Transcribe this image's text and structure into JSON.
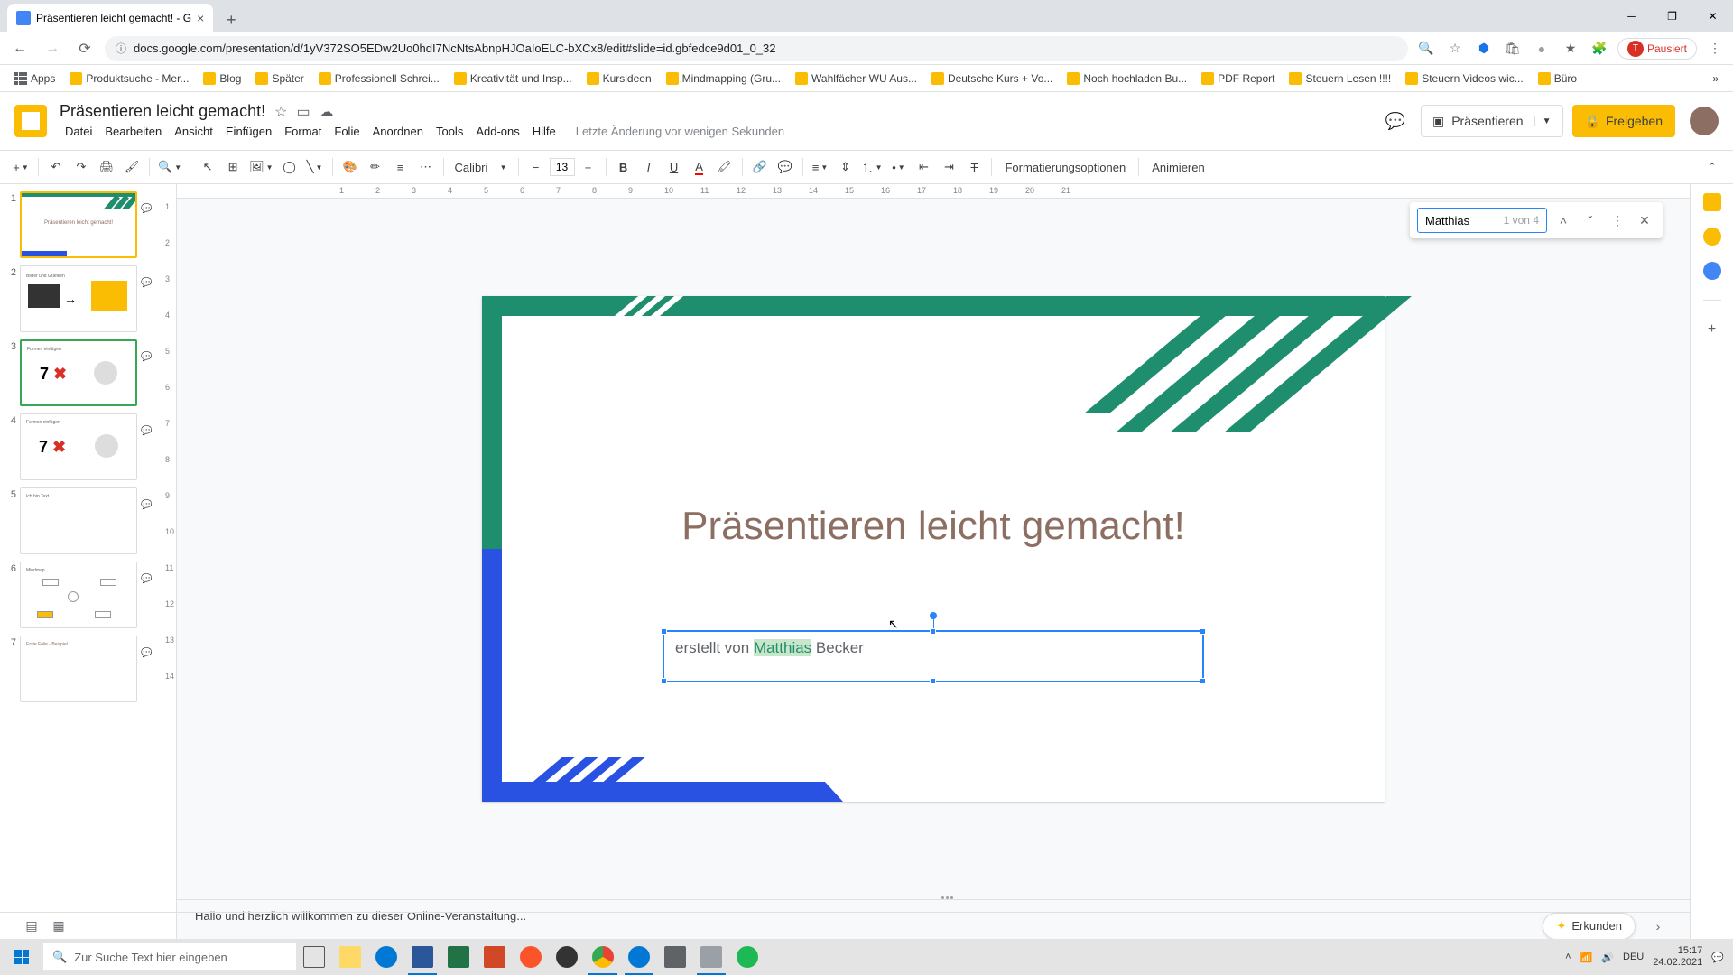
{
  "browser": {
    "tab_title": "Präsentieren leicht gemacht! - G",
    "url": "docs.google.com/presentation/d/1yV372SO5EDw2Uo0hdI7NcNtsAbnpHJOaIoELC-bXCx8/edit#slide=id.gbfedce9d01_0_32",
    "pause_label": "Pausiert"
  },
  "bookmarks": [
    "Apps",
    "Produktsuche - Mer...",
    "Blog",
    "Später",
    "Professionell Schrei...",
    "Kreativität und Insp...",
    "Kursideen",
    "Mindmapping  (Gru...",
    "Wahlfächer WU Aus...",
    "Deutsche Kurs + Vo...",
    "Noch hochladen Bu...",
    "PDF Report",
    "Steuern Lesen !!!!",
    "Steuern Videos wic...",
    "Büro"
  ],
  "doc": {
    "title": "Präsentieren leicht gemacht!",
    "last_edit": "Letzte Änderung vor wenigen Sekunden"
  },
  "menus": [
    "Datei",
    "Bearbeiten",
    "Ansicht",
    "Einfügen",
    "Format",
    "Folie",
    "Anordnen",
    "Tools",
    "Add-ons",
    "Hilfe"
  ],
  "header_buttons": {
    "present": "Präsentieren",
    "share": "Freigeben"
  },
  "toolbar": {
    "font": "Calibri",
    "font_size": "13",
    "format_options": "Formatierungsoptionen",
    "animate": "Animieren"
  },
  "find": {
    "query": "Matthias",
    "count": "1 von 4"
  },
  "slide": {
    "title": "Präsentieren leicht gemacht!",
    "subtitle_prefix": "erstellt von ",
    "subtitle_highlight": "Matthias",
    "subtitle_suffix": " Becker"
  },
  "notes": "Hallo und herzlich willkommen zu dieser Online-Veranstaltung...",
  "explore": "Erkunden",
  "ruler_h": [
    "1",
    "2",
    "3",
    "4",
    "5",
    "6",
    "7",
    "8",
    "9",
    "10",
    "11",
    "12",
    "13",
    "14",
    "15",
    "16",
    "17",
    "18",
    "19",
    "20",
    "21"
  ],
  "ruler_v": [
    "1",
    "2",
    "3",
    "4",
    "5",
    "6",
    "7",
    "8",
    "9",
    "10",
    "11",
    "12",
    "13",
    "14"
  ],
  "slide_nums": [
    "1",
    "2",
    "3",
    "4",
    "5",
    "6",
    "7"
  ],
  "taskbar": {
    "search_placeholder": "Zur Suche Text hier eingeben",
    "lang": "DEU",
    "time": "15:17",
    "date": "24.02.2021"
  }
}
